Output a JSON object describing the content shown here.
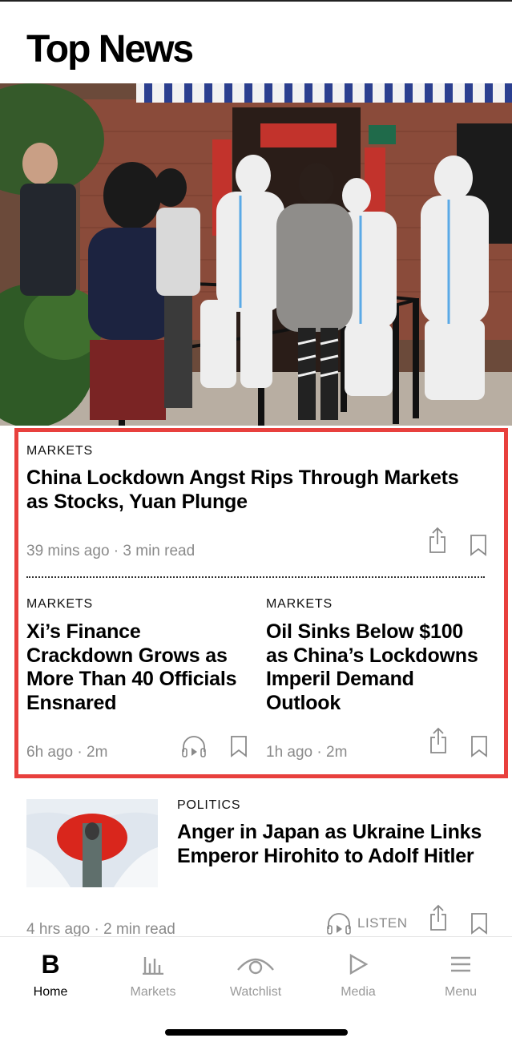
{
  "header": {
    "title": "Top News"
  },
  "lead_story": {
    "kicker": "MARKETS",
    "headline": "China Lockdown Angst Rips Through Markets as Stocks, Yuan Plunge",
    "meta": "39 mins ago · 3 min read"
  },
  "story_left": {
    "kicker": "MARKETS",
    "headline": "Xi’s Finance Crackdown Grows as More Than 40 Officials Ensnared",
    "meta": "6h ago · 2m"
  },
  "story_right": {
    "kicker": "MARKETS",
    "headline": "Oil Sinks Below $100 as China’s Lockdowns Imperil Demand Outlook",
    "meta": "1h ago · 2m"
  },
  "story_politics": {
    "kicker": "POLITICS",
    "headline": "Anger in Japan as Ukraine Links Emperor Hirohito to Adolf Hitler",
    "meta": "4 hrs ago · 2 min read",
    "listen_label": "LISTEN"
  },
  "tabbar": {
    "tabs": [
      {
        "label": "Home",
        "icon": "bloomberg-b-icon",
        "active": true
      },
      {
        "label": "Markets",
        "icon": "bar-chart-icon"
      },
      {
        "label": "Watchlist",
        "icon": "eye-icon"
      },
      {
        "label": "Media",
        "icon": "play-icon"
      },
      {
        "label": "Menu",
        "icon": "hamburger-icon"
      }
    ]
  },
  "colors": {
    "highlight_border": "#e8403d",
    "meta_gray": "#8a8a8a"
  }
}
